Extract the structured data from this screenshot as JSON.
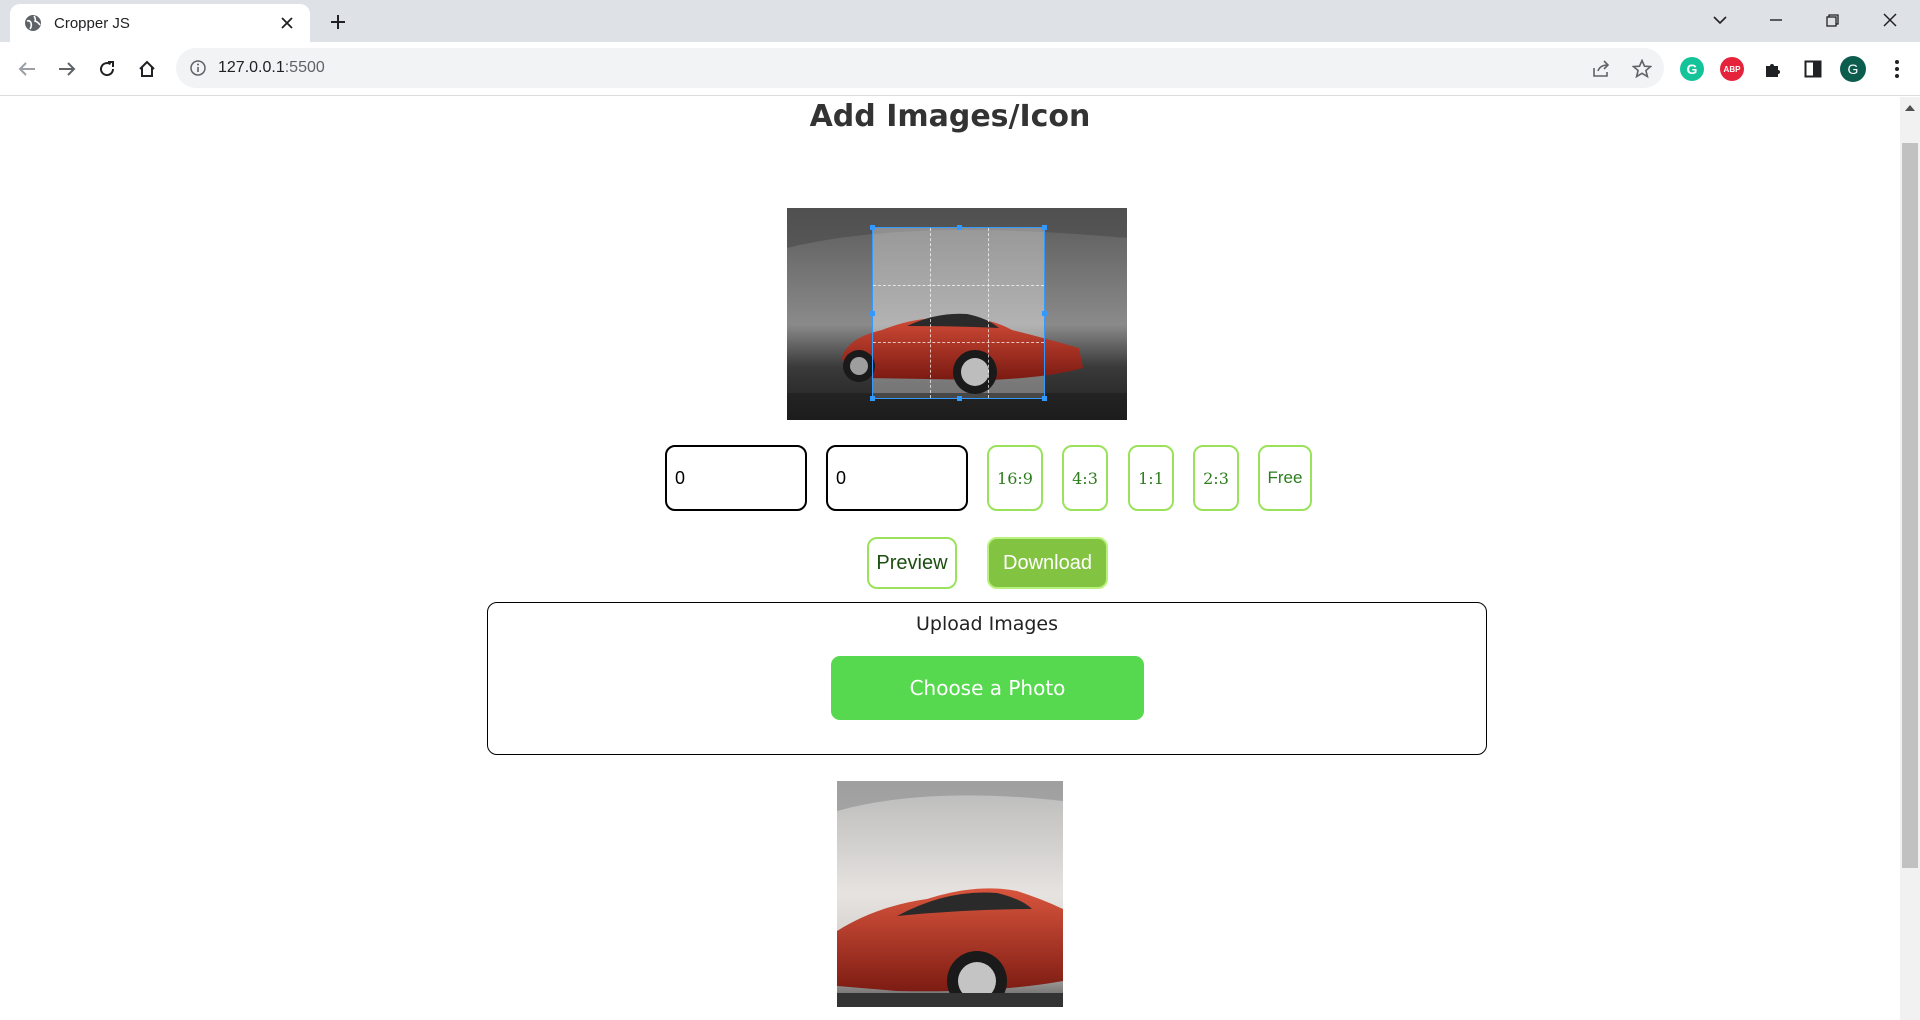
{
  "browser": {
    "tab_title": "Cropper JS",
    "url_host": "127.0.0.1",
    "url_port": ":5500",
    "extensions": {
      "grammarly_letter": "G",
      "abp_label": "ABP",
      "profile_letter": "G"
    }
  },
  "page": {
    "title": "Add Images/Icon",
    "width_input_value": "0",
    "height_input_value": "0",
    "ratios": [
      "16:9",
      "4:3",
      "1:1",
      "2:3",
      "Free"
    ],
    "preview_label": "Preview",
    "download_label": "Download",
    "upload_label": "Upload Images",
    "choose_label": "Choose a Photo"
  },
  "colors": {
    "accent_green": "#82c341",
    "choose_green": "#56d94f",
    "ratio_border": "#9be25c",
    "crop_blue": "#3399ff"
  }
}
